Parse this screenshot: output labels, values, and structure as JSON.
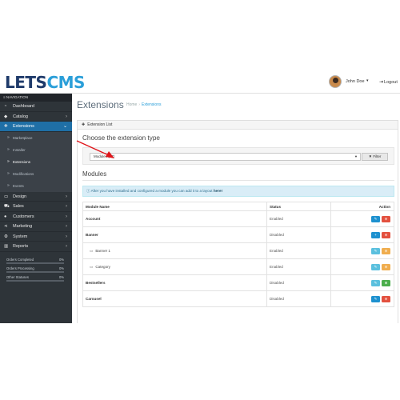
{
  "header": {
    "logo_part1": "LETS",
    "logo_part2": "CMS",
    "user_name": "John Doe",
    "logout_label": "Logout"
  },
  "sidebar": {
    "heading": "NAVIGATION",
    "items": [
      {
        "icon": "dashboard-icon",
        "label": "Dashboard"
      },
      {
        "icon": "catalog-icon",
        "label": "Catalog"
      },
      {
        "icon": "puzzle-icon",
        "label": "Extensions"
      }
    ],
    "sub_items": [
      {
        "label": "Marketplace"
      },
      {
        "label": "Installer"
      },
      {
        "label": "Extensions"
      },
      {
        "label": "Modifications"
      },
      {
        "label": "Events"
      }
    ],
    "items_after": [
      {
        "icon": "design-icon",
        "label": "Design"
      },
      {
        "icon": "sales-icon",
        "label": "Sales"
      },
      {
        "icon": "customers-icon",
        "label": "Customers"
      },
      {
        "icon": "marketing-icon",
        "label": "Marketing"
      },
      {
        "icon": "system-icon",
        "label": "System"
      },
      {
        "icon": "reports-icon",
        "label": "Reports"
      }
    ],
    "progress": [
      {
        "label": "Orders Completed",
        "value": "0%",
        "fraction": 0
      },
      {
        "label": "Orders Processing",
        "value": "0%",
        "fraction": 0
      },
      {
        "label": "Other Statuses",
        "value": "0%",
        "fraction": 0
      }
    ]
  },
  "page": {
    "title": "Extensions",
    "breadcrumb_home": "Home",
    "breadcrumb_current": "Extensions",
    "panel_heading": "Extension List",
    "choose_title": "Choose the extension type",
    "select_value": "Modules (27)",
    "filter_label": "Filter",
    "modules_title": "Modules",
    "alert_text": "After you have installed and configured a module you can add it to a layout",
    "alert_link": "here!"
  },
  "table": {
    "headers": {
      "name": "Module Name",
      "status": "Status",
      "action": "Action"
    },
    "rows": [
      {
        "name": "Account",
        "status": "Enabled"
      },
      {
        "name": "Banner",
        "status": "Disabled"
      },
      {
        "name": "Banner 1",
        "status": "Enabled"
      },
      {
        "name": "Category",
        "status": "Enabled"
      },
      {
        "name": "Bestsellers",
        "status": "Disabled"
      },
      {
        "name": "Carousel",
        "status": "Disabled"
      }
    ]
  },
  "colors": {
    "sidebar_bg": "#2e3439",
    "active_nav": "#1f6fa6",
    "edit_button": "#1e91cf",
    "uninstall_button": "#e3503e",
    "install_button": "#4cae4c",
    "annotation_arrow": "#e0161b"
  }
}
